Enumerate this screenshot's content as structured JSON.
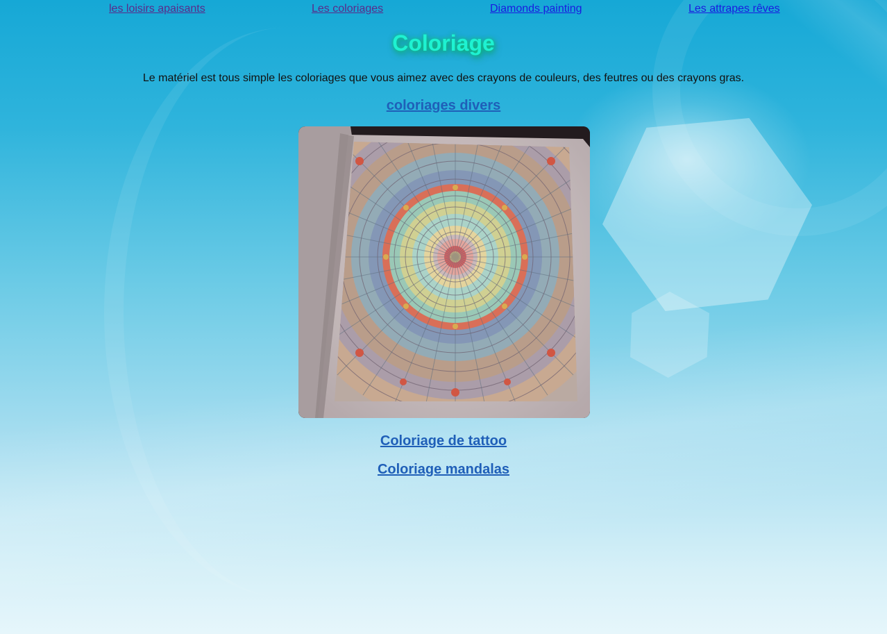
{
  "nav": {
    "items": [
      {
        "label": "les loisirs apaisants"
      },
      {
        "label": "Les coloriages"
      },
      {
        "label": "Diamonds painting"
      },
      {
        "label": "Les attrapes rêves"
      }
    ]
  },
  "page": {
    "title": "Coloriage",
    "intro": "Le matériel est tous simple les coloriages que vous aimez avec des crayons de couleurs, des feutres ou des crayons gras."
  },
  "sections": {
    "divers": "coloriages divers",
    "tattoo": "Coloriage de tattoo",
    "mandalas": "Coloriage mandalas"
  },
  "image": {
    "alt": "mandala coloring book page",
    "icon": "mandala-photo"
  },
  "colors": {
    "title": "#1ef2d2",
    "link": "#1a1ae0",
    "visited_link": "#5a2a8a",
    "section_link": "#1f5fb8"
  }
}
